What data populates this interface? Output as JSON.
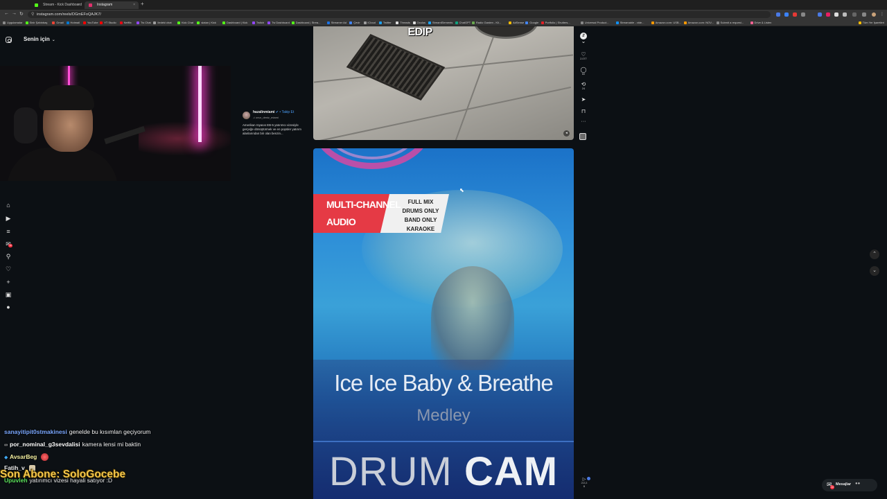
{
  "browser": {
    "tabs": [
      {
        "label": "Stream - Kick Dashboard",
        "favicon_color": "#53fc18",
        "active": false
      },
      {
        "label": "Instagram",
        "favicon_color": "#e1306c",
        "active": true
      }
    ],
    "new_tab_label": "+",
    "url": "instagram.com/reels/DGmEFoQAJK7/",
    "nav": {
      "back": "←",
      "forward": "→",
      "reload": "↻"
    },
    "bookmarks": [
      {
        "label": "Uygulamalar",
        "color": "#8c8c8c"
      },
      {
        "label": "Sinir Şahinbaş",
        "color": "#53fc18"
      },
      {
        "label": "Gmail",
        "color": "#ea4335"
      },
      {
        "label": "Hotmail",
        "color": "#0078d4"
      },
      {
        "label": "YouTube",
        "color": "#ff0000"
      },
      {
        "label": "YT Studio",
        "color": "#ff0000"
      },
      {
        "label": "Netflix",
        "color": "#e50914"
      },
      {
        "label": "Tw Chat",
        "color": "#9146ff"
      },
      {
        "label": "Iledeki chat",
        "color": "#9e9e9e"
      },
      {
        "label": "Kick Chat",
        "color": "#53fc18"
      },
      {
        "label": "slatan | Kick",
        "color": "#53fc18"
      },
      {
        "label": "Dashboard | Kick",
        "color": "#53fc18"
      },
      {
        "label": "Twitch",
        "color": "#9146ff"
      },
      {
        "label": "Tw Dashboard",
        "color": "#9146ff"
      },
      {
        "label": "Dashboard | Strea...",
        "color": "#53fc18"
      },
      {
        "label": "Streamer Ad",
        "color": "#1a73e8"
      },
      {
        "label": "Çevir",
        "color": "#4285f4"
      },
      {
        "label": "iCloud",
        "color": "#9e9e9e"
      },
      {
        "label": "Twitter",
        "color": "#1da1f2"
      },
      {
        "label": "Threads",
        "color": "#dddddd"
      },
      {
        "label": "Oculus",
        "color": "#dddddd"
      },
      {
        "label": "StreamElements",
        "color": "#1aa5ff"
      },
      {
        "label": "ChatGPT",
        "color": "#10a37f"
      },
      {
        "label": "Radio Garden - Kli...",
        "color": "#6aa84f"
      },
      {
        "label": "AdSense",
        "color": "#fbbc04"
      },
      {
        "label": "Google",
        "color": "#4285f4"
      },
      {
        "label": "Portfolio | Shutters...",
        "color": "#e32027"
      },
      {
        "label": "Universal Product...",
        "color": "#888888"
      },
      {
        "label": "Streamable - vide...",
        "color": "#0f90fa"
      },
      {
        "label": "Amazon.com: USB...",
        "color": "#ff9900"
      },
      {
        "label": "Amazon.com: NOV...",
        "color": "#ff9900"
      },
      {
        "label": "Submit a request...",
        "color": "#888888"
      },
      {
        "label": "Drive & Listen",
        "color": "#f06292"
      },
      {
        "label": "Tüm Yer İşaretleri",
        "color": "#fbbc04"
      }
    ]
  },
  "instagram": {
    "feed_title": "Senin için",
    "feed_chevron": "⌄",
    "nav_icons": [
      "home-icon",
      "reels-icon",
      "threads-icon",
      "notifications-icon",
      "search-icon",
      "heart-icon",
      "create-icon",
      "messages-icon",
      "profile-icon"
    ],
    "notification_badge": "10",
    "caption": {
      "username": "hazalinmiami",
      "verified_glyph": "✔",
      "follow_label": "• Takip Et",
      "audio": "♫ onur_deniz_miami",
      "text": "Amerikan rüyasıs EB-5 yatırımcı vizesiyle gerçeğe dönüştürmek ve en popüler yatırım alanlarından biri olan benzin..."
    },
    "reel1": {
      "overlay_text": "EDIP"
    },
    "reel2": {
      "badge_line1": "MULTI-CHANNEL",
      "badge_line2": "AUDIO",
      "options": [
        "FULL MIX",
        "DRUMS ONLY",
        "BAND ONLY",
        "KARAOKE"
      ],
      "title": "Ice Ice Baby & Breathe",
      "subtitle": "Medley",
      "footer_thin": "DRUM",
      "footer_bold": "CAM"
    },
    "actions": {
      "like_count": "2.077",
      "comment_count": "60",
      "repost_count": "24"
    },
    "reels_counter": "213,3\nB",
    "messages_label": "Mesajlar",
    "messages_badge": "10"
  },
  "stream_chat": [
    {
      "user": "sanayitipit0stmakinesi",
      "user_color": "#7aa7ff",
      "text": "genelde bu kısımlan geçiyorum",
      "icon": ""
    },
    {
      "user": "por_nominal_g3sevdalisi",
      "user_color": "#ffffff",
      "text": "kamera lensi mi baktin",
      "icon": "∞"
    },
    {
      "user": "AvsarBeg",
      "user_color": "#f5f0a0",
      "text": "",
      "icon": "◆"
    },
    {
      "user": "Fatih_v",
      "user_color": "#f0f0f0",
      "text": "",
      "icon": ""
    },
    {
      "user": "Upuvleh",
      "user_color": "#5be35b",
      "text": "yatırımcı vizesi hayali satıyor :D",
      "icon": ""
    }
  ],
  "subscriber_alert": "Son Abone: SoloGocebe",
  "colors": {
    "instagram_bg": "#0c1014",
    "link_blue": "#4a9cf5",
    "alert_gold": "#f4c64a"
  }
}
